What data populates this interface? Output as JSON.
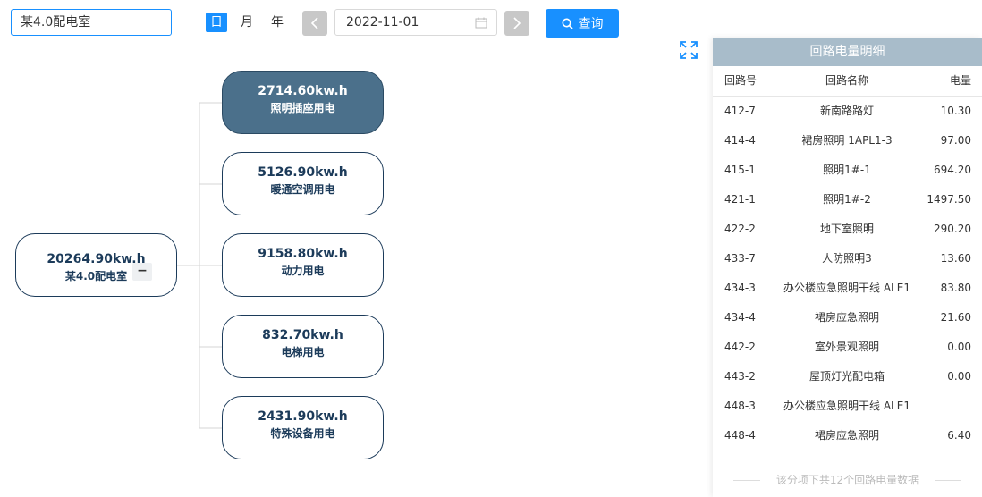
{
  "search": {
    "value": "某4.0配电室"
  },
  "tabs": [
    {
      "label": "日",
      "active": true
    },
    {
      "label": "月",
      "active": false
    },
    {
      "label": "年",
      "active": false
    }
  ],
  "date": {
    "value": "2022-11-01"
  },
  "query": {
    "label": "查询"
  },
  "colors": {
    "accent": "#1890ff",
    "node_active": "#4b708b",
    "node_border": "#1c3b5a"
  },
  "tree": {
    "root": {
      "value": "20264.90kw.h",
      "label": "某4.0配电室",
      "toggle": "−"
    },
    "children": [
      {
        "value": "2714.60kw.h",
        "label": "照明插座用电",
        "active": true
      },
      {
        "value": "5126.90kw.h",
        "label": "暖通空调用电"
      },
      {
        "value": "9158.80kw.h",
        "label": "动力用电"
      },
      {
        "value": "832.70kw.h",
        "label": "电梯用电"
      },
      {
        "value": "2431.90kw.h",
        "label": "特殊设备用电"
      }
    ]
  },
  "panel": {
    "title": "回路电量明细",
    "headers": [
      "回路号",
      "回路名称",
      "电量"
    ],
    "rows": [
      [
        "412-7",
        "新南路路灯",
        "10.30"
      ],
      [
        "414-4",
        "裙房照明 1APL1-3",
        "97.00"
      ],
      [
        "415-1",
        "照明1#-1",
        "694.20"
      ],
      [
        "421-1",
        "照明1#-2",
        "1497.50"
      ],
      [
        "422-2",
        "地下室照明",
        "290.20"
      ],
      [
        "433-7",
        "人防照明3",
        "13.60"
      ],
      [
        "434-3",
        "办公楼应急照明干线 ALE1",
        "83.80"
      ],
      [
        "434-4",
        "裙房应急照明",
        "21.60"
      ],
      [
        "442-2",
        "室外景观照明",
        "0.00"
      ],
      [
        "443-2",
        "屋顶灯光配电箱",
        "0.00"
      ],
      [
        "448-3",
        "办公楼应急照明干线 ALE1",
        ""
      ],
      [
        "448-4",
        "裙房应急照明",
        "6.40"
      ]
    ],
    "footer": "该分项下共12个回路电量数据"
  }
}
